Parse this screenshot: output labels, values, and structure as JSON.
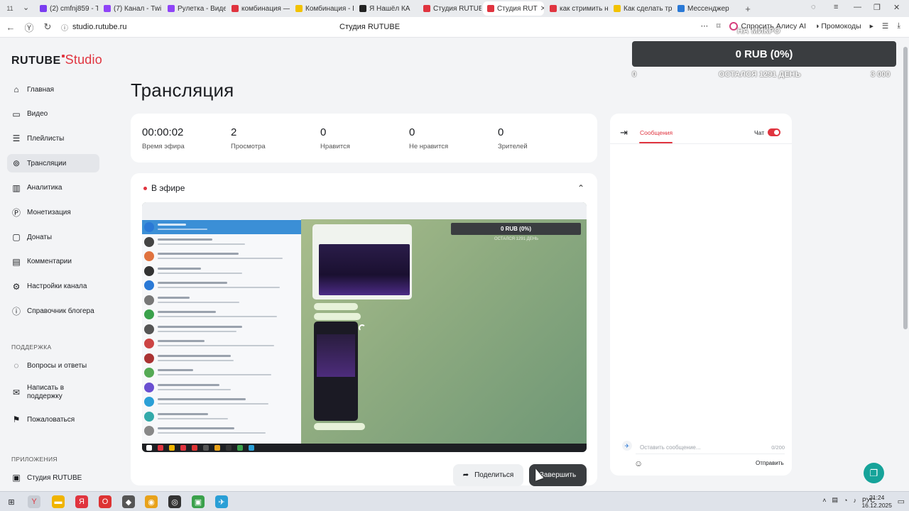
{
  "browser": {
    "first_tab_label": "11",
    "tabs": [
      {
        "label": "(2) cmfnj859 - T",
        "color": "#7a3cf0"
      },
      {
        "label": "(7) Канал - Twi",
        "color": "#8f44f7"
      },
      {
        "label": "Рулетка - Виде",
        "color": "#8f44f7"
      },
      {
        "label": "комбинация —",
        "color": "#e0343f"
      },
      {
        "label": "Комбинация - E",
        "color": "#f2c200"
      },
      {
        "label": "Я Нашёл КА",
        "color": "#222222"
      },
      {
        "label": "Студия RUTUB",
        "color": "#e0343f"
      },
      {
        "label": "Студия RUT",
        "color": "#e0343f",
        "active": true
      },
      {
        "label": "как стримить н",
        "color": "#e0343f"
      },
      {
        "label": "Как сделать тр",
        "color": "#f2c200"
      },
      {
        "label": "Мессенджер",
        "color": "#2a79d6"
      }
    ],
    "close_glyph": "✕",
    "new_tab_glyph": "+",
    "url": "studio.rutube.ru",
    "page_title": "Студия RUTUBE",
    "alisa_label": "Спросить Алису AI",
    "promo_label": "Промокоды"
  },
  "overlay": {
    "label": "НА МИКРО",
    "amount": "0 RUB (0%)",
    "min": "0",
    "remaining": "ОСТАЛСЯ 1291 ДЕНЬ",
    "max": "3 000"
  },
  "logo": {
    "brand": "RUTUBE",
    "product": "Studio",
    "brand_color": "#e0343f"
  },
  "sidebar": {
    "items": [
      {
        "label": "Главная",
        "icon": "home-icon"
      },
      {
        "label": "Видео",
        "icon": "video-icon"
      },
      {
        "label": "Плейлисты",
        "icon": "playlist-icon"
      },
      {
        "label": "Трансляции",
        "icon": "broadcast-icon",
        "active": true
      },
      {
        "label": "Аналитика",
        "icon": "analytics-icon"
      },
      {
        "label": "Монетизация",
        "icon": "ruble-icon"
      },
      {
        "label": "Донаты",
        "icon": "donate-icon"
      },
      {
        "label": "Комментарии",
        "icon": "comment-icon"
      },
      {
        "label": "Настройки канала",
        "icon": "settings-icon"
      },
      {
        "label": "Справочник блогера",
        "icon": "help-book-icon"
      }
    ],
    "support_heading": "ПОДДЕРЖКА",
    "support_items": [
      {
        "label": "Вопросы и ответы",
        "icon": "faq-icon"
      },
      {
        "label": "Написать в поддержку",
        "icon": "mail-icon"
      },
      {
        "label": "Пожаловаться",
        "icon": "flag-icon"
      }
    ],
    "apps_heading": "ПРИЛОЖЕНИЯ",
    "apps_items": [
      {
        "label": "Студия RUTUBE",
        "icon": "studio-icon"
      }
    ]
  },
  "main": {
    "title": "Трансляция",
    "stats": [
      {
        "value": "00:00:02",
        "label": "Время эфира"
      },
      {
        "value": "2",
        "label": "Просмотра"
      },
      {
        "value": "0",
        "label": "Нравится"
      },
      {
        "value": "0",
        "label": "Не нравится"
      },
      {
        "value": "0",
        "label": "Зрителей"
      }
    ],
    "live_label": "В эфире",
    "live_dot_color": "#e0343f",
    "preview": {
      "donate_text": "0 RUB (0%)",
      "donate_sub": "ОСТАЛСЯ 1291 ДЕНЬ"
    },
    "share_label": "Поделиться",
    "end_label": "Завершить"
  },
  "chat": {
    "tab_messages": "Сообщения",
    "toggle_label": "Чат",
    "toggle_on": true,
    "input_placeholder": "Оставить сообщение...",
    "char_count": "0/200",
    "send_label": "Отправить"
  },
  "taskbar": {
    "lang": "РУС",
    "time": "21:24",
    "date": "16.12.2025"
  }
}
